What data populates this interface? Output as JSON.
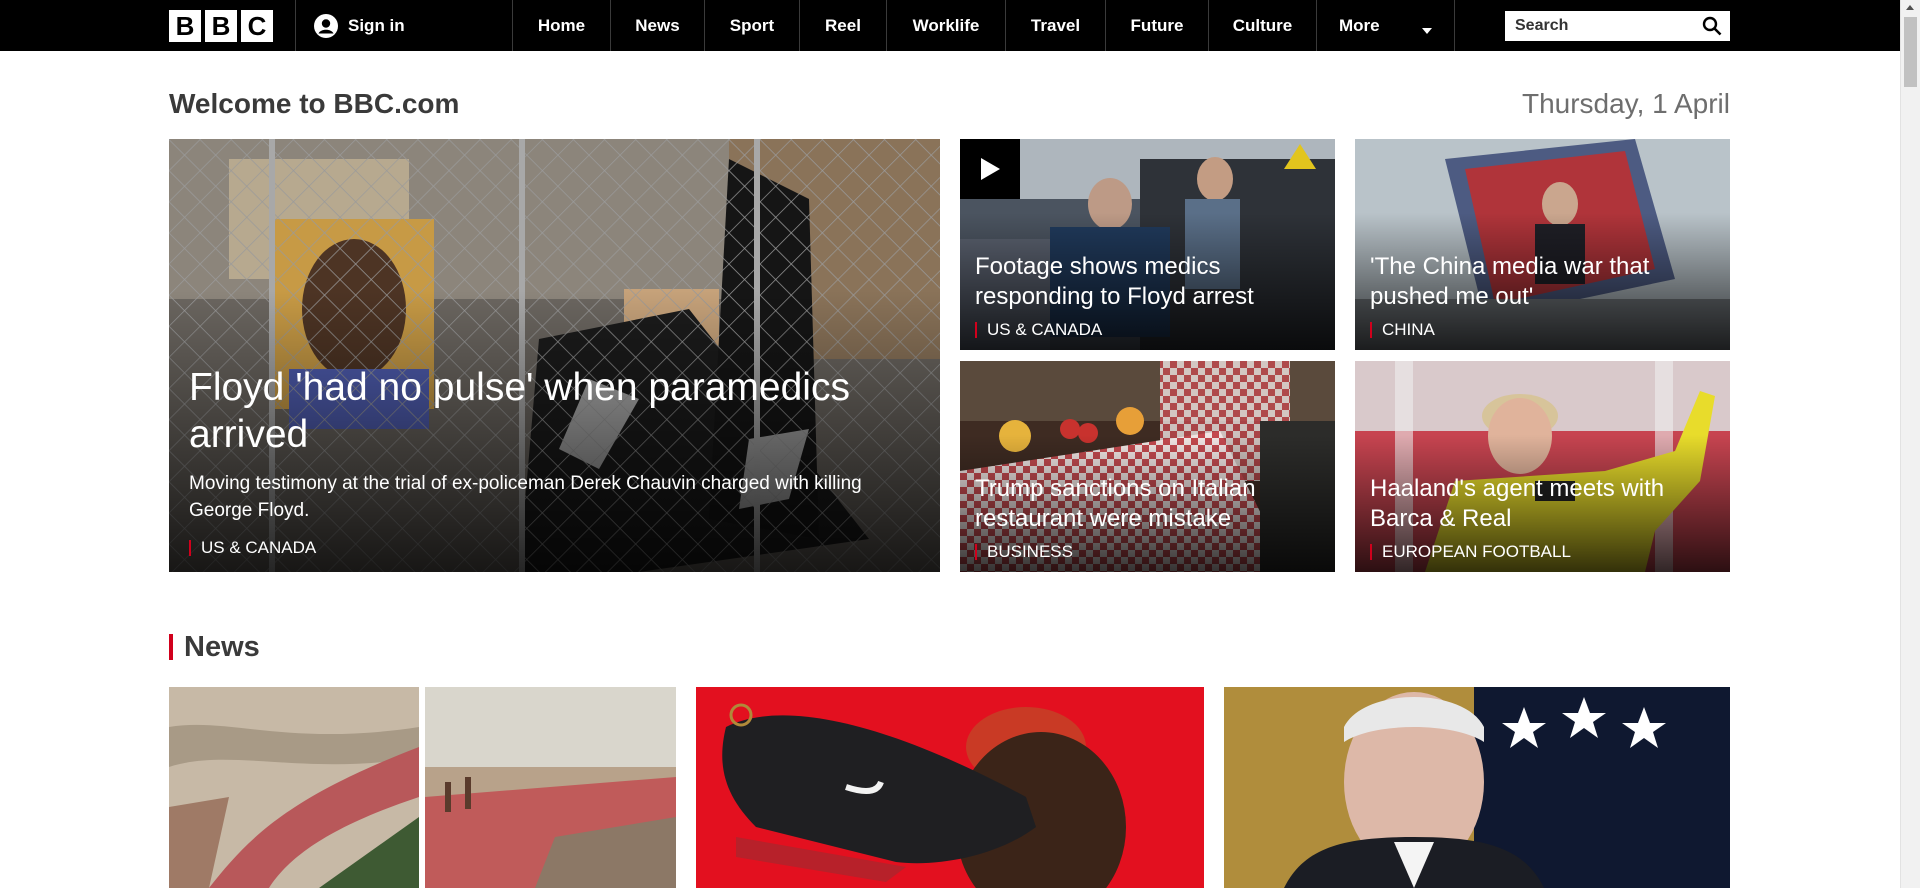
{
  "nav": {
    "logo_letters": [
      "B",
      "B",
      "C"
    ],
    "signin_label": "Sign in",
    "items": [
      {
        "label": "Home"
      },
      {
        "label": "News"
      },
      {
        "label": "Sport"
      },
      {
        "label": "Reel"
      },
      {
        "label": "Worklife"
      },
      {
        "label": "Travel"
      },
      {
        "label": "Future"
      },
      {
        "label": "Culture"
      }
    ],
    "more_label": "More",
    "search_placeholder": "Search"
  },
  "welcome": {
    "title": "Welcome to BBC.com",
    "date": "Thursday, 1 April"
  },
  "lead": {
    "headline": "Floyd 'had no pulse' when paramedics arrived",
    "summary": "Moving testimony at the trial of ex-policeman Derek Chauvin charged with killing George Floyd.",
    "tag": "US & CANADA"
  },
  "promos": [
    {
      "headline": "Footage shows medics responding to Floyd arrest",
      "tag": "US & CANADA"
    },
    {
      "headline": "'The China media war that pushed me out'",
      "tag": "CHINA"
    },
    {
      "headline": "Trump sanctions on Italian restaurant were mistake",
      "tag": "BUSINESS"
    },
    {
      "headline": "Haaland's agent meets with Barca & Real",
      "tag": "EUROPEAN FOOTBALL"
    }
  ],
  "news": {
    "title": "News"
  },
  "colors": {
    "accent_red": "#d1001c",
    "nav_bg": "#000000"
  },
  "icons": [
    "user-icon",
    "play-icon",
    "search-icon",
    "chevron-down-icon"
  ]
}
